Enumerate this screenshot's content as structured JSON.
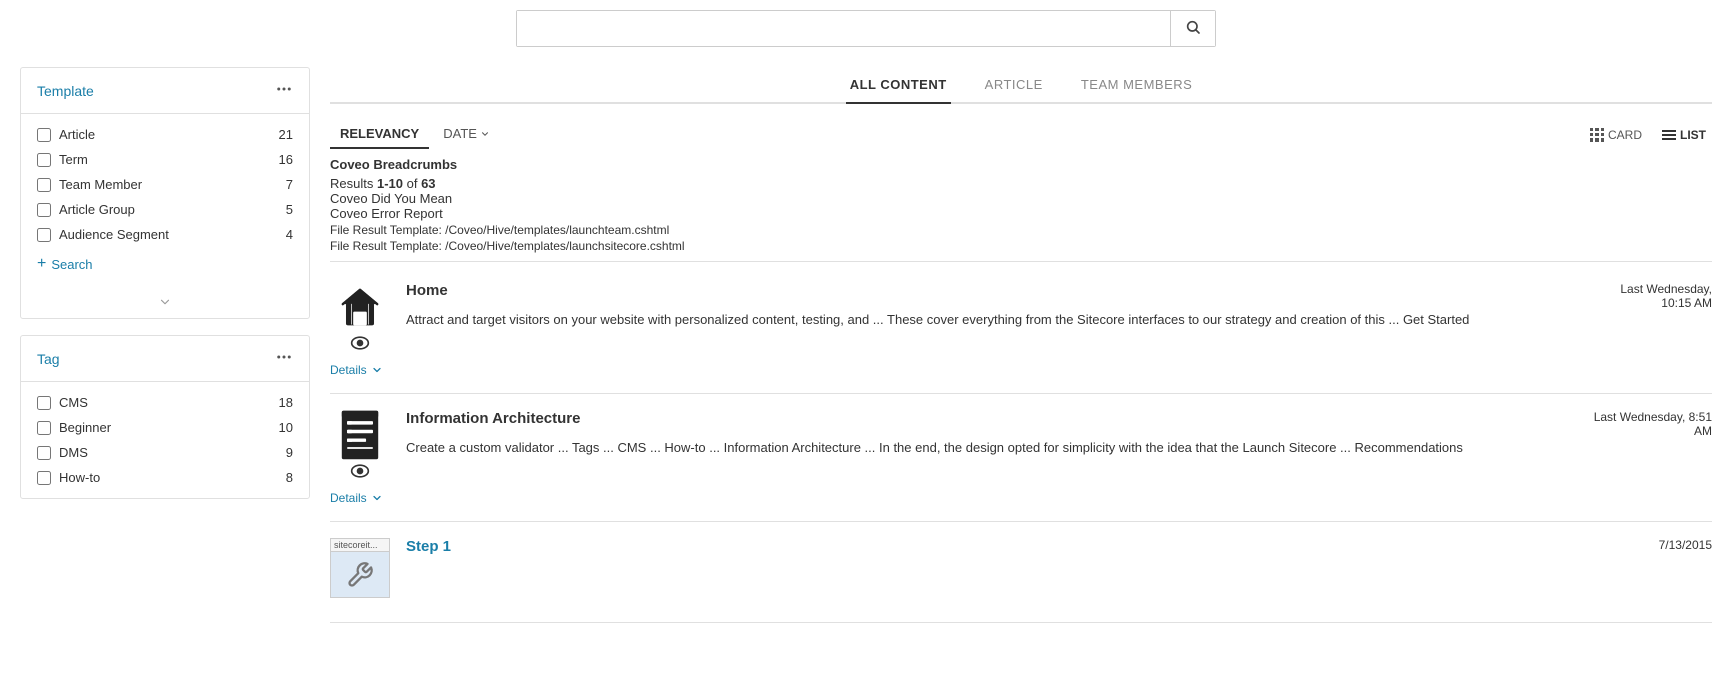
{
  "topSearch": {
    "placeholder": "",
    "searchBtnLabel": "🔍"
  },
  "tabs": [
    {
      "id": "all-content",
      "label": "ALL CONTENT",
      "active": true
    },
    {
      "id": "article",
      "label": "ARTICLE",
      "active": false
    },
    {
      "id": "team-members",
      "label": "TEAM MEMBERS",
      "active": false
    }
  ],
  "sortOptions": [
    {
      "id": "relevancy",
      "label": "RELEVANCY",
      "active": true
    },
    {
      "id": "date",
      "label": "DATE",
      "active": false,
      "hasArrow": true
    }
  ],
  "viewOptions": {
    "card": "CARD",
    "list": "LIST"
  },
  "breadcrumbs": {
    "title": "Coveo Breadcrumbs",
    "resultsText": "Results ",
    "resultsRange": "1-10",
    "resultsOf": " of ",
    "resultsTotal": "63",
    "didYouMean": "Coveo Did You Mean",
    "errorReport": "Coveo Error Report",
    "fileResult1": "File Result Template: /Coveo/Hive/templates/launchteam.cshtml",
    "fileResult2": "File Result Template: /Coveo/Hive/templates/launchsitecore.cshtml"
  },
  "results": [
    {
      "id": "home",
      "icon": "house",
      "title": "Home",
      "date": "Last Wednesday,\n10:15 AM",
      "snippet": "Attract and target visitors on your website with personalized content, testing, and ... These cover everything from the Sitecore interfaces to our strategy and creation of this ... Get Started",
      "detailsLabel": "Details"
    },
    {
      "id": "information-architecture",
      "icon": "document",
      "title": "Information Architecture",
      "date": "Last Wednesday, 8:51\nAM",
      "snippet": "Create a custom validator ... Tags ... CMS ... How-to ... Information Architecture ... In the end, the design opted for simplicity with the idea that the Launch Sitecore ... Recommendations",
      "detailsLabel": "Details"
    },
    {
      "id": "step-1",
      "icon": "thumbnail",
      "title": "Step 1",
      "date": "7/13/2015",
      "thumbnailLabel": "sitecoreit...",
      "snippet": "",
      "detailsLabel": ""
    }
  ],
  "templateFacet": {
    "title": "Template",
    "items": [
      {
        "label": "Article",
        "count": 21
      },
      {
        "label": "Term",
        "count": 16
      },
      {
        "label": "Team Member",
        "count": 7
      },
      {
        "label": "Article Group",
        "count": 5
      },
      {
        "label": "Audience Segment",
        "count": 4
      }
    ],
    "searchLabel": "Search"
  },
  "tagFacet": {
    "title": "Tag",
    "items": [
      {
        "label": "CMS",
        "count": 18
      },
      {
        "label": "Beginner",
        "count": 10
      },
      {
        "label": "DMS",
        "count": 9
      },
      {
        "label": "How-to",
        "count": 8
      }
    ]
  }
}
